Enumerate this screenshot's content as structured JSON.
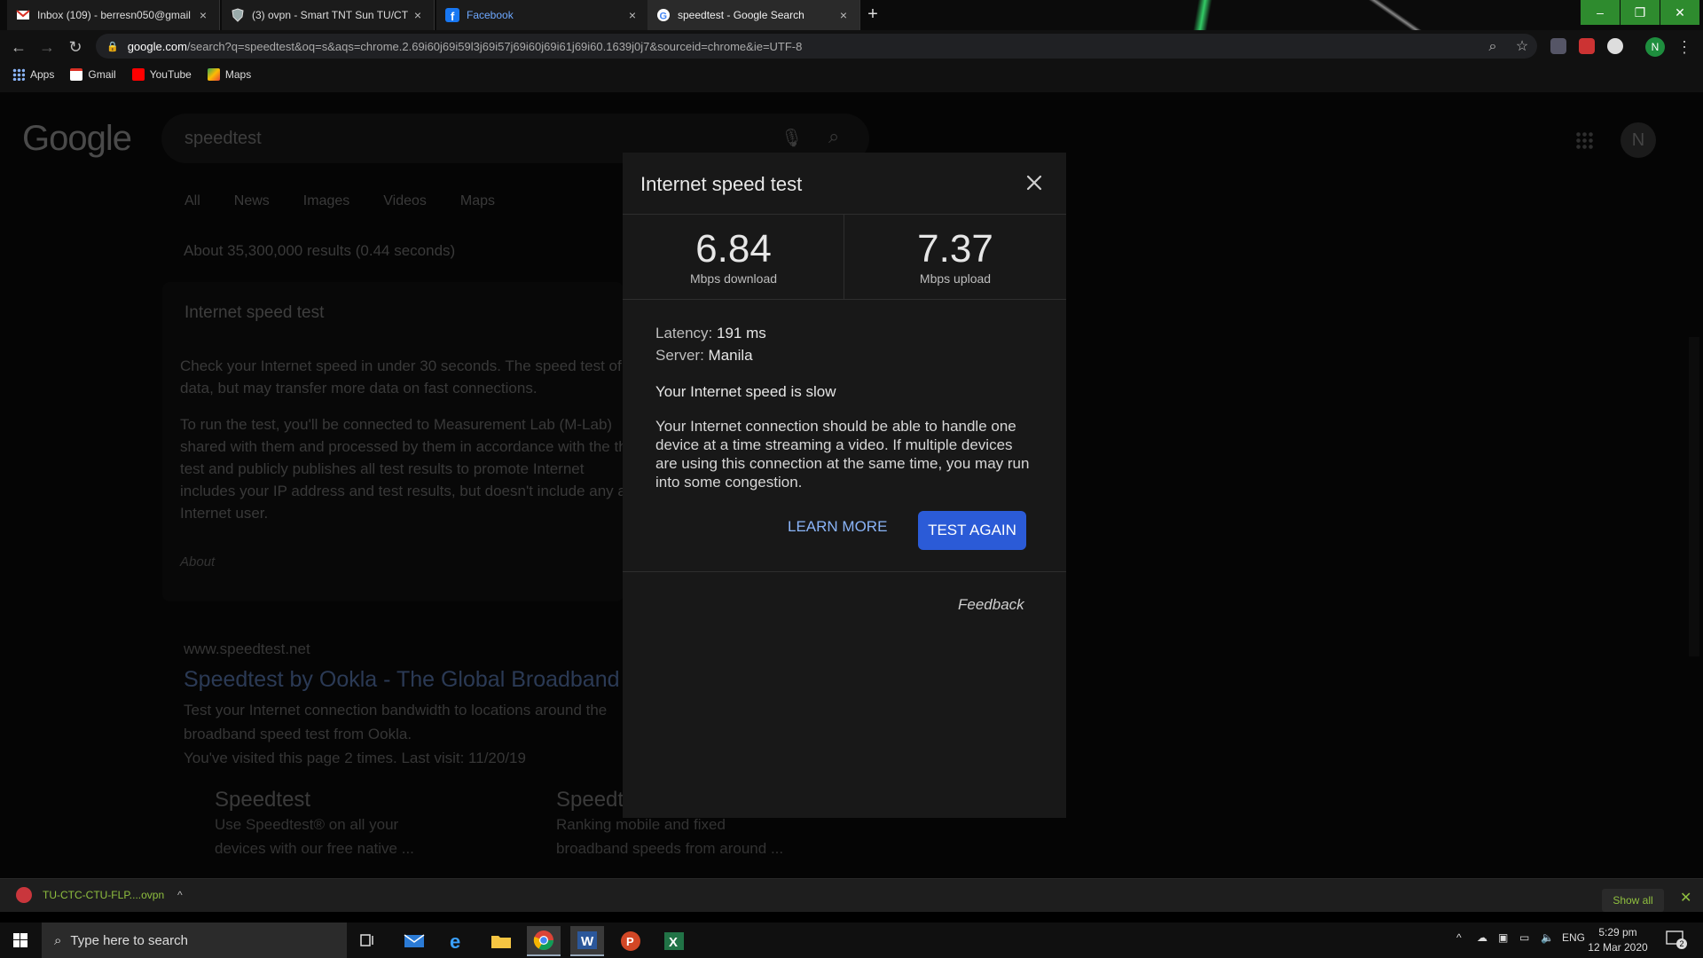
{
  "browser": {
    "tabs": [
      {
        "label": "Inbox (109) - berresn050@gmail",
        "icon": "gmail-icon"
      },
      {
        "label": "(3) ovpn - Smart TNT Sun TU/CT",
        "icon": "shield-icon"
      },
      {
        "label": "Facebook",
        "icon": "facebook-icon"
      },
      {
        "label": "speedtest - Google Search",
        "icon": "google-icon"
      }
    ],
    "url_host": "google.com",
    "url_path": "/search?q=speedtest&oq=s&aqs=chrome.2.69i60j69i59l3j69i57j69i60j69i61j69i60.1639j0j7&sourceid=chrome&ie=UTF-8",
    "profile_initial": "N",
    "bookmarks": [
      "Apps",
      "Gmail",
      "YouTube",
      "Maps"
    ]
  },
  "search": {
    "logo": "Google",
    "query": "speedtest",
    "tabs": [
      "All",
      "News",
      "Images",
      "Videos",
      "Maps"
    ],
    "result_stats": "About 35,300,000 results (0.44 seconds)",
    "card_title": "Internet speed test",
    "card_para1": "Check your Internet speed in under 30 seconds. The speed test of data, but may transfer more data on fast connections.",
    "card_para2": "To run the test, you'll be connected to Measurement Lab (M-Lab) shared with them and processed by them in accordance with the the test and publicly publishes all test results to promote Internet includes your IP address and test results, but doesn't include any an Internet user.",
    "about": "About",
    "site_url": "www.speedtest.net",
    "site_title": "Speedtest by Ookla - The Global Broadband",
    "site_desc": "Test your Internet connection bandwidth to locations around the broadband speed test from Ookla.",
    "site_visited": "You've visited this page 2 times. Last visit: 11/20/19",
    "sublink1_title": "Speedtest",
    "sublink1_desc": "Use Speedtest® on all your devices with our free native ...",
    "sublink2_title": "Speedt",
    "sublink2_desc": "Ranking mobile and fixed broadband speeds from around ..."
  },
  "speedtest": {
    "title": "Internet speed test",
    "download_value": "6.84",
    "download_label": "Mbps download",
    "upload_value": "7.37",
    "upload_label": "Mbps upload",
    "latency_label": "Latency:",
    "latency_value": "191 ms",
    "server_label": "Server:",
    "server_value": "Manila",
    "verdict": "Your Internet speed is slow",
    "explanation": "Your Internet connection should be able to handle one device at a time streaming a video. If multiple devices are using this connection at the same time, you may run into some congestion.",
    "learn_more": "LEARN MORE",
    "test_again": "TEST AGAIN",
    "feedback": "Feedback"
  },
  "downloads": {
    "file": "TU-CTC-CTU-FLP....ovpn",
    "show_all": "Show all"
  },
  "taskbar": {
    "search_placeholder": "Type here to search",
    "language": "ENG",
    "time": "5:29 pm",
    "date": "12 Mar 2020",
    "notification_count": "2"
  },
  "colors": {
    "accent_button": "#2b5bd7",
    "link": "#8ab4f8",
    "window_controls": "#2e8b2e",
    "download_text": "#8fbf3f"
  }
}
